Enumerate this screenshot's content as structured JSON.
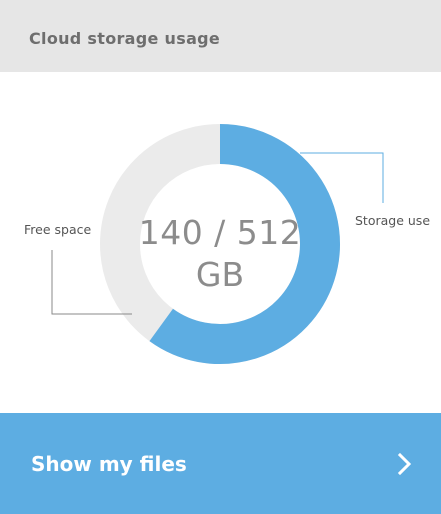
{
  "header": {
    "title": "Cloud storage usage"
  },
  "storage": {
    "used_gb": 140,
    "total_gb": 512,
    "value_text": "140 / 512",
    "unit": "GB",
    "free_label": "Free space",
    "used_label": "Storage use"
  },
  "colors": {
    "used": "#5dade2",
    "free": "#ebebeb",
    "header_bg": "#e6e6e6",
    "button_bg": "#5dade2"
  },
  "footer": {
    "button_label": "Show my files",
    "icon": "chevron-right-icon"
  }
}
